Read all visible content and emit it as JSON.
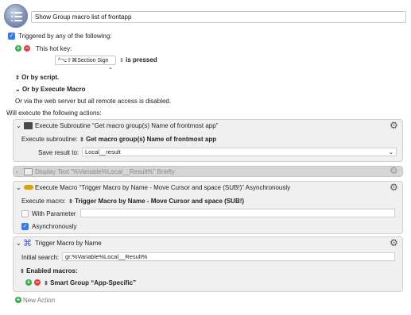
{
  "macro": {
    "name": "Show Group macro list of frontapp",
    "icon": "list-icon"
  },
  "triggers": {
    "checkbox_label": "Triggered by any of the following:",
    "hotkey_label": "This hot key:",
    "hotkey_value": "^⌥⇧⌘Section Sign",
    "hotkey_state": "is pressed",
    "by_script": "Or by script.",
    "by_execute_macro": "Or by Execute Macro",
    "web_server_note": "Or via the web server but all remote access is disabled."
  },
  "actions_header": "Will execute the following actions:",
  "actions": [
    {
      "title": "Execute Subroutine “Get macro group(s) Name of frontmost app”",
      "subroutine_label": "Execute subroutine:",
      "subroutine_value": "Get macro group(s) Name of frontmost app",
      "save_label": "Save result to:",
      "save_value": "Local__result"
    },
    {
      "title": "Display Text “%Variable%Local__Result%” Briefly",
      "disabled": true
    },
    {
      "title": "Execute Macro “Trigger Macro by Name - Move Cursor and space (SUB!)” Asynchronously",
      "macro_label": "Execute macro:",
      "macro_value": "Trigger Macro by Name - Move Cursor and space (SUB!)",
      "with_parameter_label": "With Parameter",
      "with_parameter_checked": false,
      "async_label": "Asynchronously",
      "async_checked": true
    },
    {
      "title": "Trigger Macro by Name",
      "search_label": "Initial search:",
      "search_value": "gr:%Variable%Local__Result%",
      "enabled_label": "Enabled macros:",
      "group_value": "Smart Group “App-Specific”"
    }
  ],
  "new_action": "New Action",
  "colors": {
    "accent": "#2f7cf6",
    "add_green": "#2eae4b",
    "remove_red": "#e0443e"
  }
}
